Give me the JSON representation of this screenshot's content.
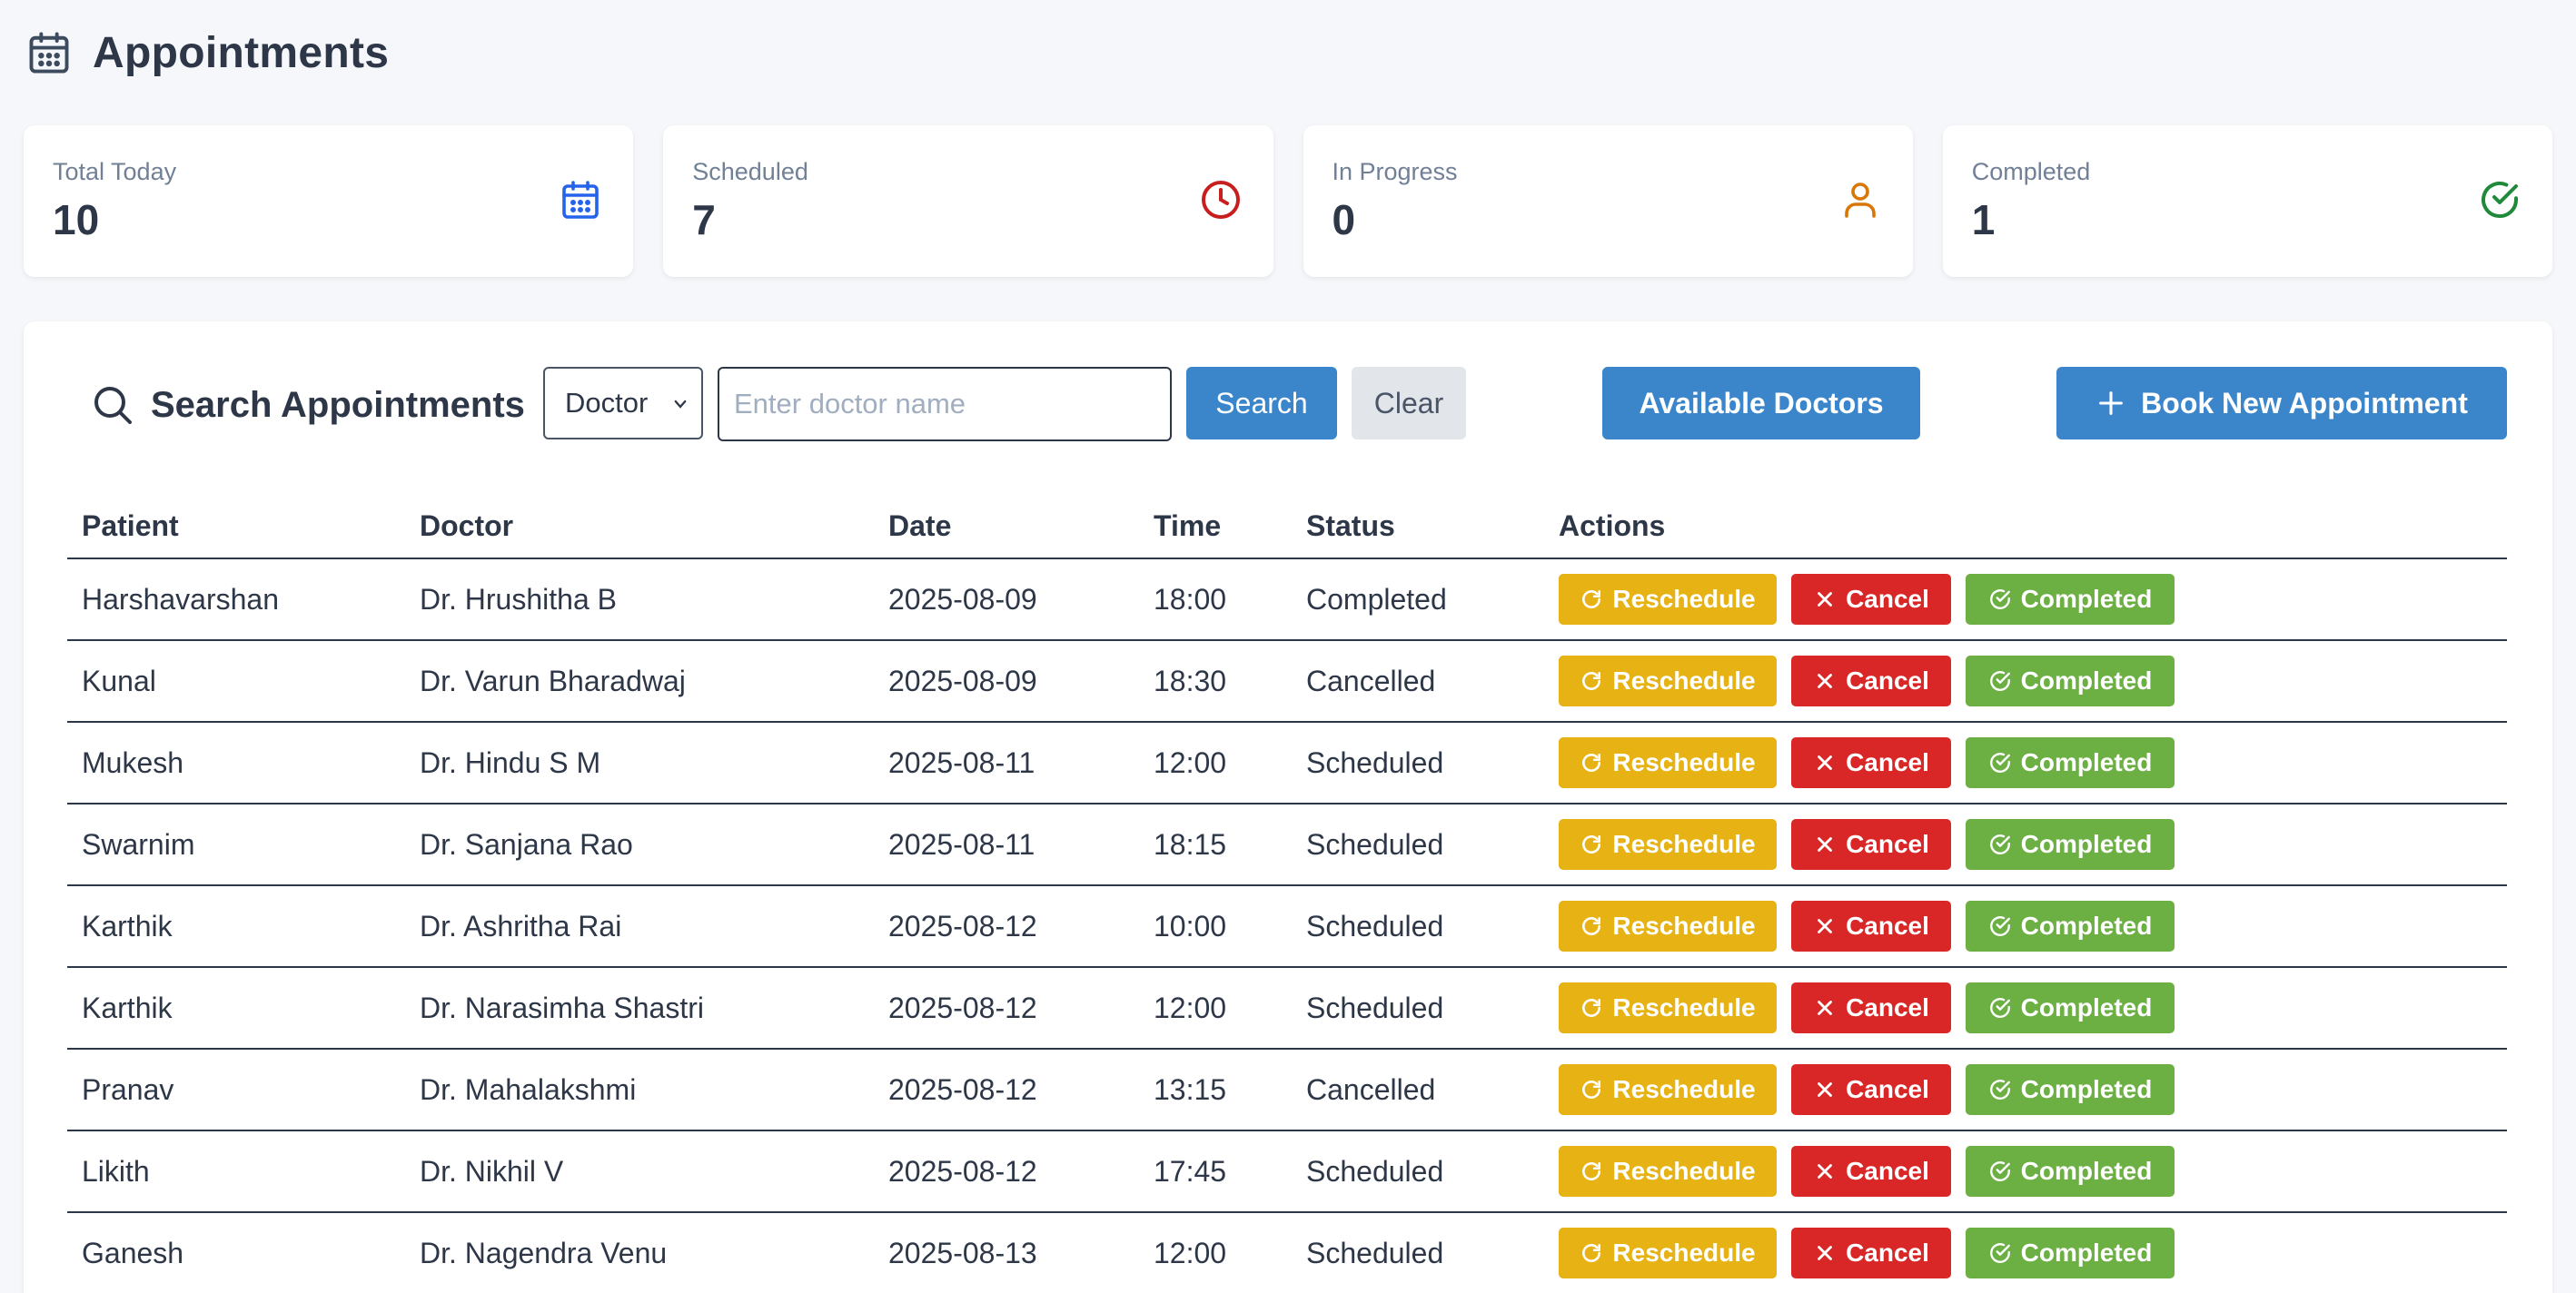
{
  "header": {
    "title": "Appointments",
    "icon": "calendar-icon"
  },
  "stats": [
    {
      "label": "Total Today",
      "value": "10",
      "icon": "calendar-icon",
      "color": "#2563eb"
    },
    {
      "label": "Scheduled",
      "value": "7",
      "icon": "clock-icon",
      "color": "#c81e1e"
    },
    {
      "label": "In Progress",
      "value": "0",
      "icon": "user-icon",
      "color": "#d97706"
    },
    {
      "label": "Completed",
      "value": "1",
      "icon": "check-circle-icon",
      "color": "#1f8a3a"
    }
  ],
  "search": {
    "title": "Search Appointments",
    "filter_selected": "Doctor",
    "placeholder": "Enter doctor name",
    "value": "",
    "search_label": "Search",
    "clear_label": "Clear"
  },
  "toolbar": {
    "available_doctors_label": "Available Doctors",
    "book_label": "Book New Appointment"
  },
  "table": {
    "columns": [
      "Patient",
      "Doctor",
      "Date",
      "Time",
      "Status",
      "Actions"
    ],
    "actions": {
      "reschedule": "Reschedule",
      "cancel": "Cancel",
      "completed": "Completed"
    },
    "rows": [
      {
        "patient": "Harshavarshan",
        "doctor": "Dr. Hrushitha B",
        "date": "2025-08-09",
        "time": "18:00",
        "status": "Completed"
      },
      {
        "patient": "Kunal",
        "doctor": "Dr. Varun Bharadwaj",
        "date": "2025-08-09",
        "time": "18:30",
        "status": "Cancelled"
      },
      {
        "patient": "Mukesh",
        "doctor": "Dr. Hindu S M",
        "date": "2025-08-11",
        "time": "12:00",
        "status": "Scheduled"
      },
      {
        "patient": "Swarnim",
        "doctor": "Dr. Sanjana Rao",
        "date": "2025-08-11",
        "time": "18:15",
        "status": "Scheduled"
      },
      {
        "patient": "Karthik",
        "doctor": "Dr. Ashritha Rai",
        "date": "2025-08-12",
        "time": "10:00",
        "status": "Scheduled"
      },
      {
        "patient": "Karthik",
        "doctor": "Dr. Narasimha Shastri",
        "date": "2025-08-12",
        "time": "12:00",
        "status": "Scheduled"
      },
      {
        "patient": "Pranav",
        "doctor": "Dr. Mahalakshmi",
        "date": "2025-08-12",
        "time": "13:15",
        "status": "Cancelled"
      },
      {
        "patient": "Likith",
        "doctor": "Dr. Nikhil V",
        "date": "2025-08-12",
        "time": "17:45",
        "status": "Scheduled"
      },
      {
        "patient": "Ganesh",
        "doctor": "Dr. Nagendra Venu",
        "date": "2025-08-13",
        "time": "12:00",
        "status": "Scheduled"
      }
    ]
  }
}
